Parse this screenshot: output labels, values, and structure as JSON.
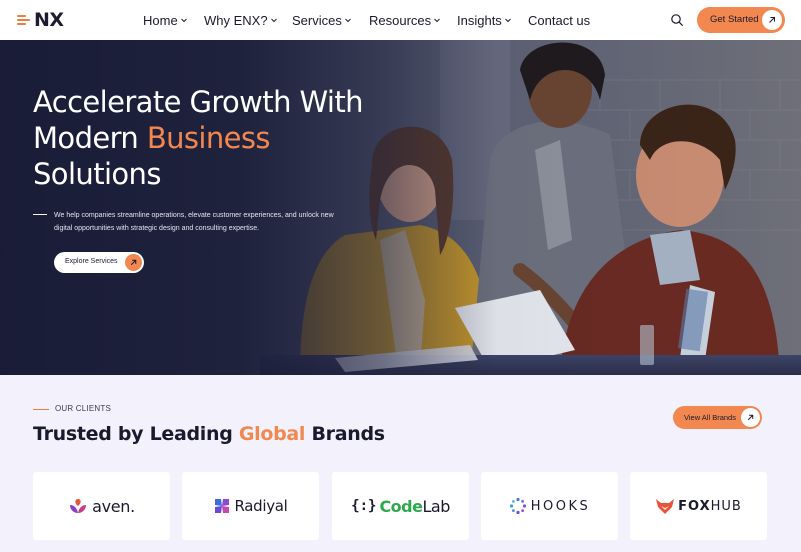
{
  "nav": {
    "logo_text": "NX",
    "menu": [
      {
        "label": "Home",
        "has_dropdown": true
      },
      {
        "label": "Why ENX?",
        "has_dropdown": true
      },
      {
        "label": "Services",
        "has_dropdown": true
      },
      {
        "label": "Resources",
        "has_dropdown": true
      },
      {
        "label": "Insights",
        "has_dropdown": true
      },
      {
        "label": "Contact us",
        "has_dropdown": false
      }
    ],
    "search_icon": "search-icon",
    "cta_label": "Get Started"
  },
  "hero": {
    "title_part1": "Accelerate Growth With Modern ",
    "title_accent": "Business",
    "title_part2": "Solutions",
    "description": "We help companies streamline operations, elevate customer experiences, and unlock new digital opportunities with strategic design and consulting expertise.",
    "button_label": "Explore Services"
  },
  "clients": {
    "eyebrow": "OUR CLIENTS",
    "title_part1": "Trusted by Leading ",
    "title_accent": "Global",
    "title_part2": " Brands",
    "view_all_label": "View All Brands",
    "brands": [
      {
        "name": "aven.",
        "icon": "aven-logo-icon"
      },
      {
        "name": "Radiyal",
        "icon": "radiyal-logo-icon"
      },
      {
        "name_prefix": "{:}",
        "name_code": "Code",
        "name_lab": "Lab",
        "icon": "codelab-logo-icon"
      },
      {
        "name": "HOOKS",
        "icon": "hooks-logo-icon"
      },
      {
        "name_strong": "FOX",
        "name_light": "HUB",
        "icon": "foxhub-logo-icon"
      }
    ]
  },
  "colors": {
    "accent": "#f2874f",
    "page_bg": "#f3f2fc",
    "hero_overlay": "#1b1e38",
    "text_dark": "#1a1a2e"
  }
}
